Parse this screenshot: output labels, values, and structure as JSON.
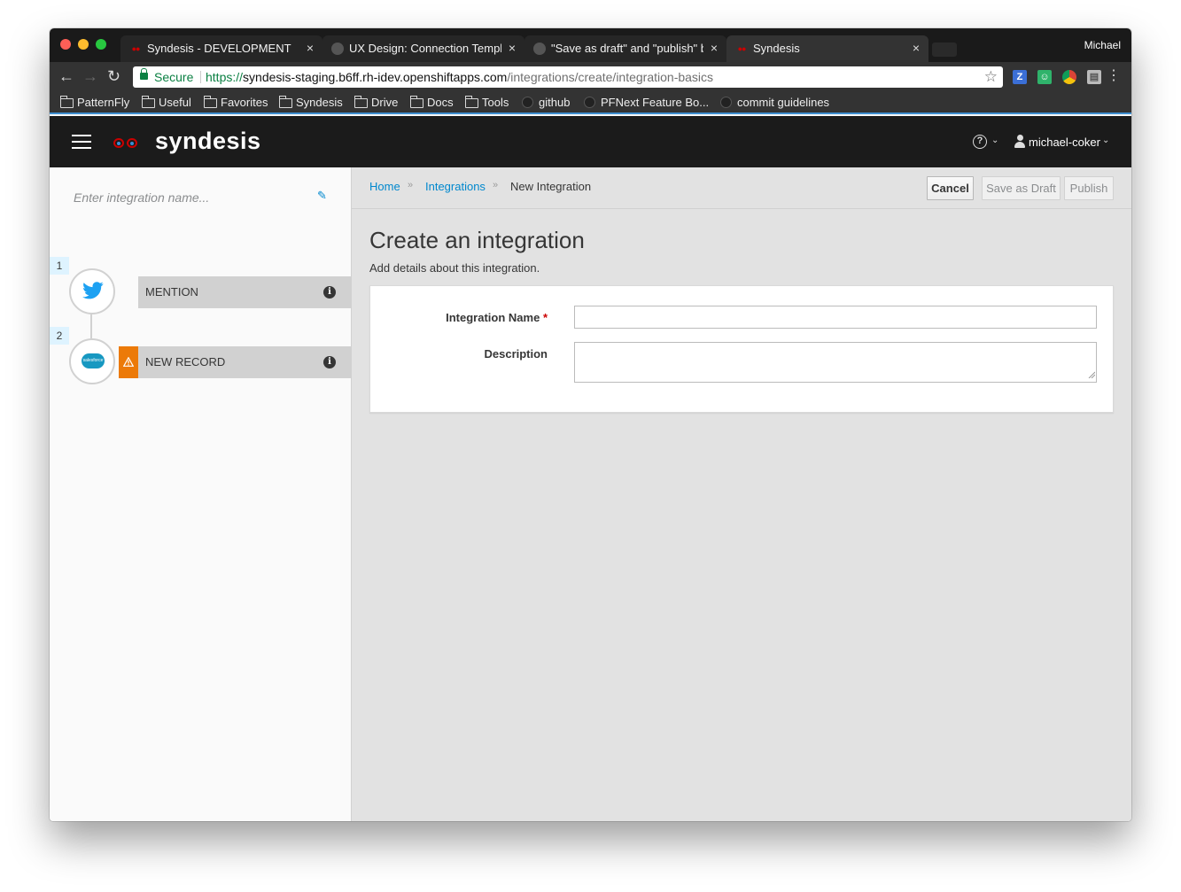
{
  "browser": {
    "tabs": [
      {
        "title": "Syndesis - DEVELOPMENT",
        "favicon": "syndesis-favicon",
        "active": false
      },
      {
        "title": "UX Design: Connection Templ",
        "favicon": "github-favicon",
        "active": false
      },
      {
        "title": "\"Save as draft\" and \"publish\" b",
        "favicon": "github-favicon",
        "active": false
      },
      {
        "title": "Syndesis",
        "favicon": "syndesis-favicon",
        "active": true
      }
    ],
    "tab_close_glyph": "×",
    "profile_name": "Michael",
    "address_bar": {
      "secure_label": "Secure",
      "url_scheme": "https://",
      "url_host": "syndesis-staging.b6ff.rh-idev.openshiftapps.com",
      "url_path": "/integrations/create/integration-basics"
    },
    "bookmarks": [
      {
        "label": "PatternFly",
        "icon": "folder-icon"
      },
      {
        "label": "Useful",
        "icon": "folder-icon"
      },
      {
        "label": "Favorites",
        "icon": "folder-icon"
      },
      {
        "label": "Syndesis",
        "icon": "folder-icon"
      },
      {
        "label": "Drive",
        "icon": "folder-icon"
      },
      {
        "label": "Docs",
        "icon": "folder-icon"
      },
      {
        "label": "Tools",
        "icon": "folder-icon"
      },
      {
        "label": "github",
        "icon": "github-icon"
      },
      {
        "label": "PFNext Feature Bo...",
        "icon": "github-icon"
      },
      {
        "label": "commit guidelines",
        "icon": "github-icon"
      }
    ]
  },
  "app_header": {
    "brand": "syndesis",
    "help_glyph": "?",
    "username": "michael-coker"
  },
  "sidebar": {
    "name_placeholder": "Enter integration name...",
    "steps": [
      {
        "number": "1",
        "label": "MENTION",
        "icon": "twitter-icon",
        "warning": false
      },
      {
        "number": "2",
        "label": "NEW RECORD",
        "icon": "salesforce-icon",
        "warning": true
      }
    ],
    "salesforce_logo_text": "salesforce",
    "info_glyph": "i"
  },
  "breadcrumb": {
    "home": "Home",
    "integrations": "Integrations",
    "current": "New Integration",
    "separator": "»"
  },
  "actions": {
    "cancel": "Cancel",
    "save_draft": "Save as Draft",
    "publish": "Publish"
  },
  "page": {
    "title": "Create an integration",
    "subtitle": "Add details about this integration."
  },
  "form": {
    "name_label": "Integration Name",
    "required_marker": "*",
    "name_value": "",
    "description_label": "Description",
    "description_value": ""
  },
  "colors": {
    "accent_link": "#0088ce",
    "warning": "#ec7a08",
    "header_bg": "#1b1b1b",
    "brand_red": "#cc0000"
  }
}
